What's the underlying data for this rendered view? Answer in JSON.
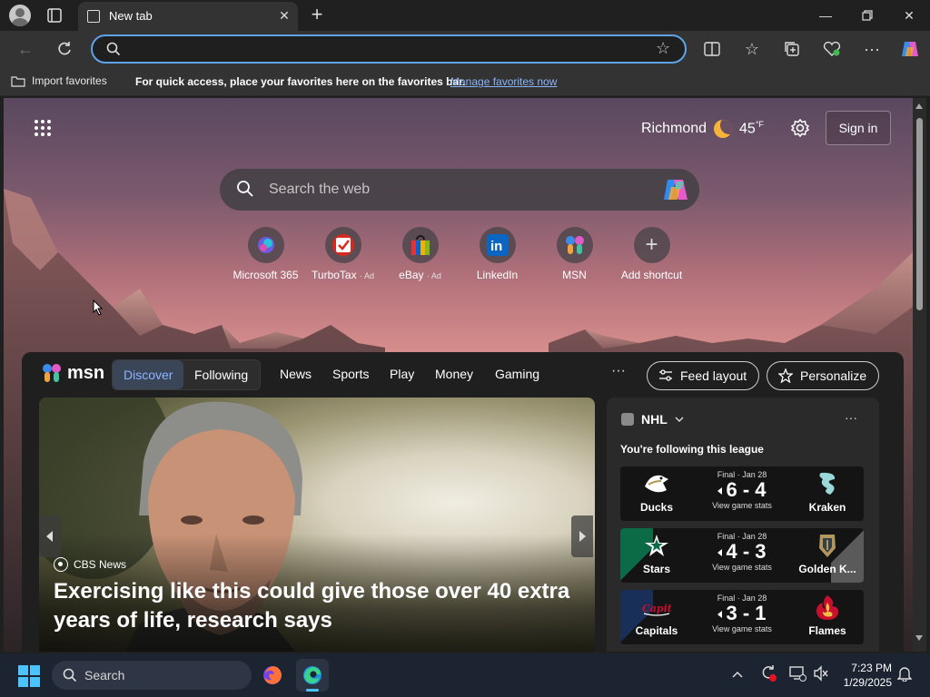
{
  "browser": {
    "tab_title": "New tab",
    "address_value": "",
    "favorites_bar": {
      "import_label": "Import favorites",
      "message": "For quick access, place your favorites here on the favorites bar.",
      "manage_link": "Manage favorites now"
    }
  },
  "newtab": {
    "weather": {
      "city": "Richmond",
      "temp": "45",
      "unit": "°F"
    },
    "sign_in": "Sign in",
    "search_placeholder": "Search the web",
    "shortcuts": [
      {
        "label": "Microsoft 365",
        "ad": ""
      },
      {
        "label": "TurboTax",
        "ad": "· Ad"
      },
      {
        "label": "eBay",
        "ad": "· Ad"
      },
      {
        "label": "LinkedIn",
        "ad": ""
      },
      {
        "label": "MSN",
        "ad": ""
      },
      {
        "label": "Add shortcut",
        "ad": ""
      }
    ]
  },
  "feed": {
    "brand": "msn",
    "toggle": {
      "discover": "Discover",
      "following": "Following"
    },
    "nav": [
      "News",
      "Sports",
      "Play",
      "Money",
      "Gaming"
    ],
    "more": "···",
    "feed_layout": "Feed layout",
    "personalize": "Personalize",
    "hero": {
      "source": "CBS News",
      "title": "Exercising like this could give those over 40 extra years of life, research says"
    },
    "nhl": {
      "league": "NHL",
      "subtitle": "You're following this league",
      "more": "···",
      "games": [
        {
          "status": "Final · Jan 28",
          "home": "Ducks",
          "away": "Kraken",
          "score": "6 - 4",
          "stats": "View game stats",
          "home_color": "#b5985a",
          "away_color": "#355464"
        },
        {
          "status": "Final · Jan 28",
          "home": "Stars",
          "away": "Golden K...",
          "score": "4 - 3",
          "stats": "View game stats",
          "home_color": "#0a6b46",
          "away_color": "#8a7a56"
        },
        {
          "status": "Final · Jan 28",
          "home": "Capitals",
          "away": "Flames",
          "score": "3 - 1",
          "stats": "View game stats",
          "home_color": "#1a2f57",
          "away_color": "#c8102e"
        }
      ]
    }
  },
  "taskbar": {
    "search_label": "Search",
    "time": "7:23 PM",
    "date": "1/29/2025"
  }
}
